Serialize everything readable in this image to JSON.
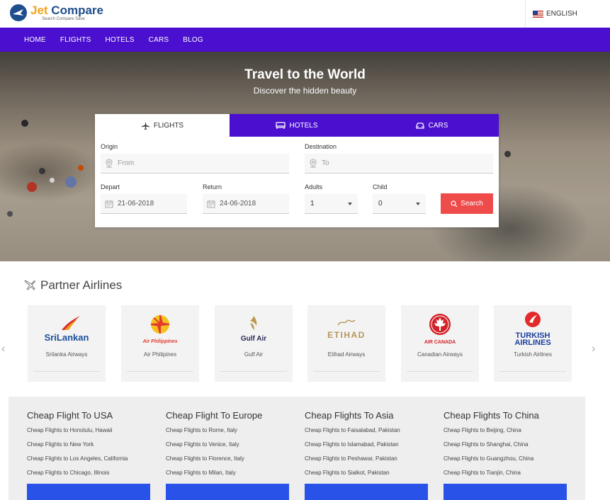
{
  "header": {
    "logo_jet": "Jet",
    "logo_compare": " Compare",
    "logo_tagline": "Search Compare Save",
    "language": "ENGLISH"
  },
  "nav": [
    "HOME",
    "FLIGHTS",
    "HOTELS",
    "CARS",
    "BLOG"
  ],
  "hero": {
    "title": "Travel to the World",
    "subtitle": "Discover the hidden beauty"
  },
  "search": {
    "tabs": [
      {
        "label": "FLIGHTS",
        "active": true
      },
      {
        "label": "HOTELS",
        "active": false
      },
      {
        "label": "CARS",
        "active": false
      }
    ],
    "origin_label": "Origin",
    "origin_placeholder": "From",
    "destination_label": "Destination",
    "destination_placeholder": "To",
    "depart_label": "Depart",
    "depart_value": "21-06-2018",
    "return_label": "Return",
    "return_value": "24-06-2018",
    "adults_label": "Adults",
    "adults_value": "1",
    "child_label": "Child",
    "child_value": "0",
    "search_button": "Search"
  },
  "partners": {
    "title": "Partner Airlines",
    "airlines": [
      {
        "name": "Srilanka Airways",
        "logo_text": "SriLankan",
        "color": "#1a4f9c"
      },
      {
        "name": "Air Philipines",
        "logo_text": "Air Philippines",
        "color": "#e33b2e"
      },
      {
        "name": "Gulf Air",
        "logo_text": "Gulf Air",
        "color": "#2a2a5a"
      },
      {
        "name": "Etihad Airways",
        "logo_text": "ETIHAD",
        "color": "#b8955a"
      },
      {
        "name": "Canadian Airways",
        "logo_text": "AIR CANADA",
        "color": "#d2232a"
      },
      {
        "name": "Turkish Airlines",
        "logo_text": "TURKISH AIRLINES",
        "color": "#1b3f9e"
      }
    ]
  },
  "cheap_flights": [
    {
      "title": "Cheap Flight To USA",
      "links": [
        "Cheap Flights to Honolulu, Hawaii",
        "Cheap Flights to New York",
        "Cheap Flights to Los Angeles, California",
        "Cheap Flights to Chicago, Illinois"
      ]
    },
    {
      "title": "Cheap Flight To Europe",
      "links": [
        "Cheap Flights to Rome, Italy",
        "Cheap Flights to Venice, Italy",
        "Cheap Flights to Florence, Italy",
        "Cheap Flights to Milan, Italy"
      ]
    },
    {
      "title": "Cheap Flights To Asia",
      "links": [
        "Cheap Flights to Faisalabad, Pakistan",
        "Cheap Flights to Islamabad, Pakistan",
        "Cheap Flights to Peshawar, Pakistan",
        "Cheap Flights to Sialkot, Pakistan"
      ]
    },
    {
      "title": "Cheap Flights To China",
      "links": [
        "Cheap Flights to Beijing, China",
        "Cheap Flights to Shanghai, China",
        "Cheap Flights to Guangzhou, China",
        "Cheap Flights to Tianjin, China"
      ]
    }
  ],
  "colors": {
    "nav": "#4a0fcf",
    "search_button": "#ef4b4b",
    "view_button": "#2952e8"
  }
}
